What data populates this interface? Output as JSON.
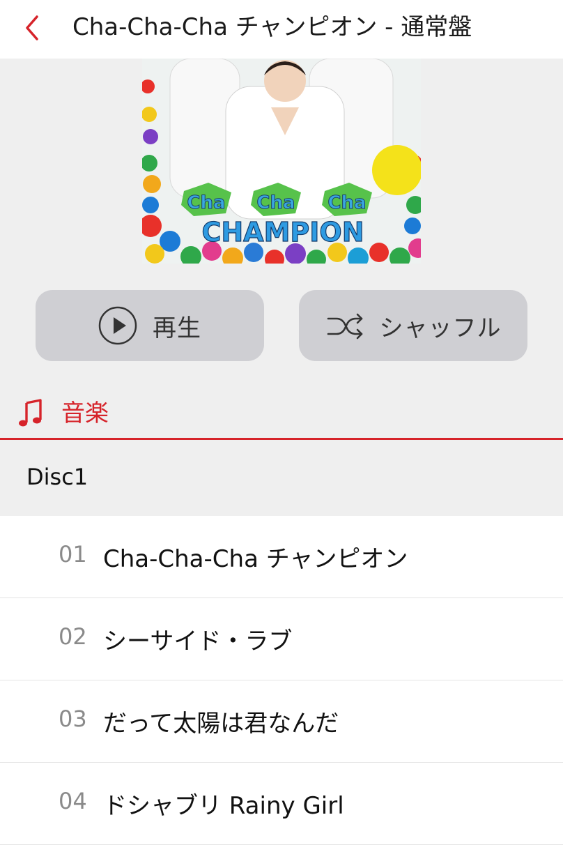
{
  "header": {
    "title": "Cha-Cha-Cha チャンピオン - 通常盤",
    "back_icon": "chevron-left-icon",
    "accent_color": "#d6232a"
  },
  "artwork": {
    "lines": [
      "Cha",
      "Cha",
      "Cha",
      "CHAMPION"
    ]
  },
  "actions": {
    "play_label": "再生",
    "play_icon": "play-circle-icon",
    "shuffle_label": "シャッフル",
    "shuffle_icon": "shuffle-icon"
  },
  "section": {
    "label": "音楽",
    "icon": "music-note-icon"
  },
  "disc": {
    "label": "Disc1"
  },
  "tracks": [
    {
      "number": "01",
      "title": "Cha-Cha-Cha チャンピオン"
    },
    {
      "number": "02",
      "title": "シーサイド・ラブ"
    },
    {
      "number": "03",
      "title": "だって太陽は君なんだ"
    },
    {
      "number": "04",
      "title": "ドシャブリ Rainy Girl"
    }
  ]
}
